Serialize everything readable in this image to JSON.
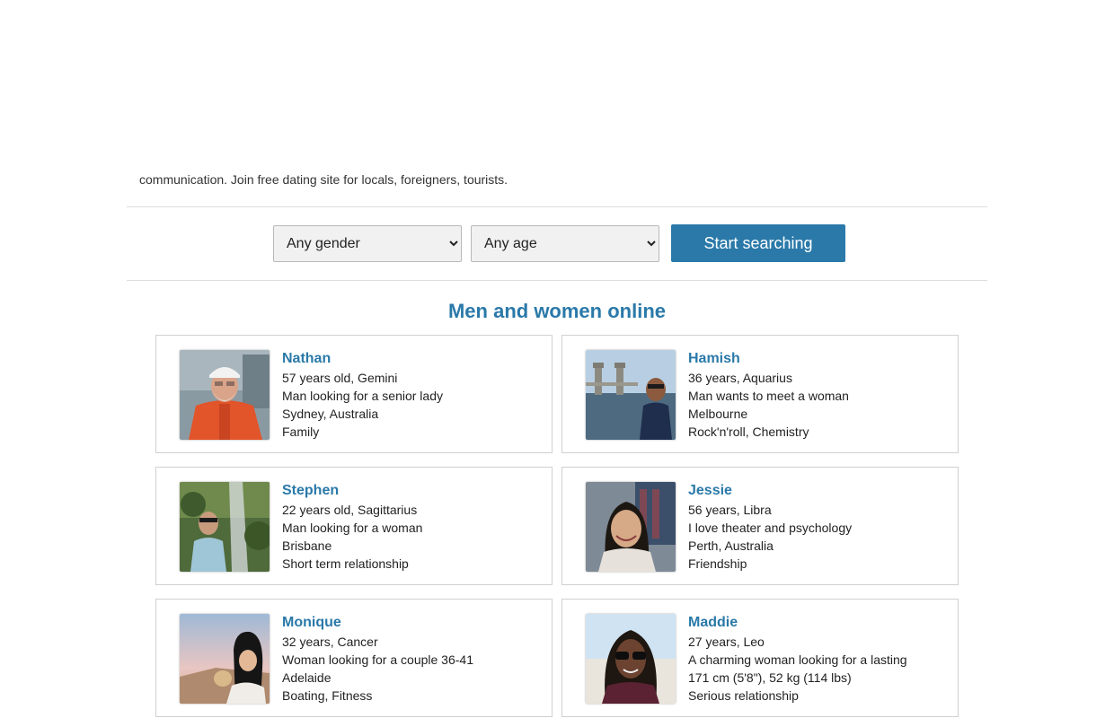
{
  "intro": {
    "text": "communication. Join free dating site for locals, foreigners, tourists."
  },
  "search": {
    "gender_selected": "Any gender",
    "age_selected": "Any age",
    "button_label": "Start searching"
  },
  "section_title": "Men and women online",
  "profiles": [
    {
      "name": "Nathan",
      "line1": "57 years old, Gemini",
      "line2": "Man looking for a senior lady",
      "line3": "Sydney, Australia",
      "line4": "Family"
    },
    {
      "name": "Hamish",
      "line1": "36 years, Aquarius",
      "line2": "Man wants to meet a woman",
      "line3": "Melbourne",
      "line4": "Rock'n'roll, Chemistry"
    },
    {
      "name": "Stephen",
      "line1": "22 years old, Sagittarius",
      "line2": "Man looking for a woman",
      "line3": "Brisbane",
      "line4": "Short term relationship"
    },
    {
      "name": "Jessie",
      "line1": "56 years, Libra",
      "line2": "I love theater and psychology",
      "line3": "Perth, Australia",
      "line4": "Friendship"
    },
    {
      "name": "Monique",
      "line1": "32 years, Cancer",
      "line2": "Woman looking for a couple 36-41",
      "line3": "Adelaide",
      "line4": "Boating, Fitness"
    },
    {
      "name": "Maddie",
      "line1": "27 years, Leo",
      "line2": "A charming woman looking for a lasting",
      "line3": "171 cm (5'8\"), 52 kg (114 lbs)",
      "line4": "Serious relationship"
    }
  ],
  "colors": {
    "accent": "#2a79a9",
    "border": "#d0d0d0",
    "text": "#222222"
  }
}
